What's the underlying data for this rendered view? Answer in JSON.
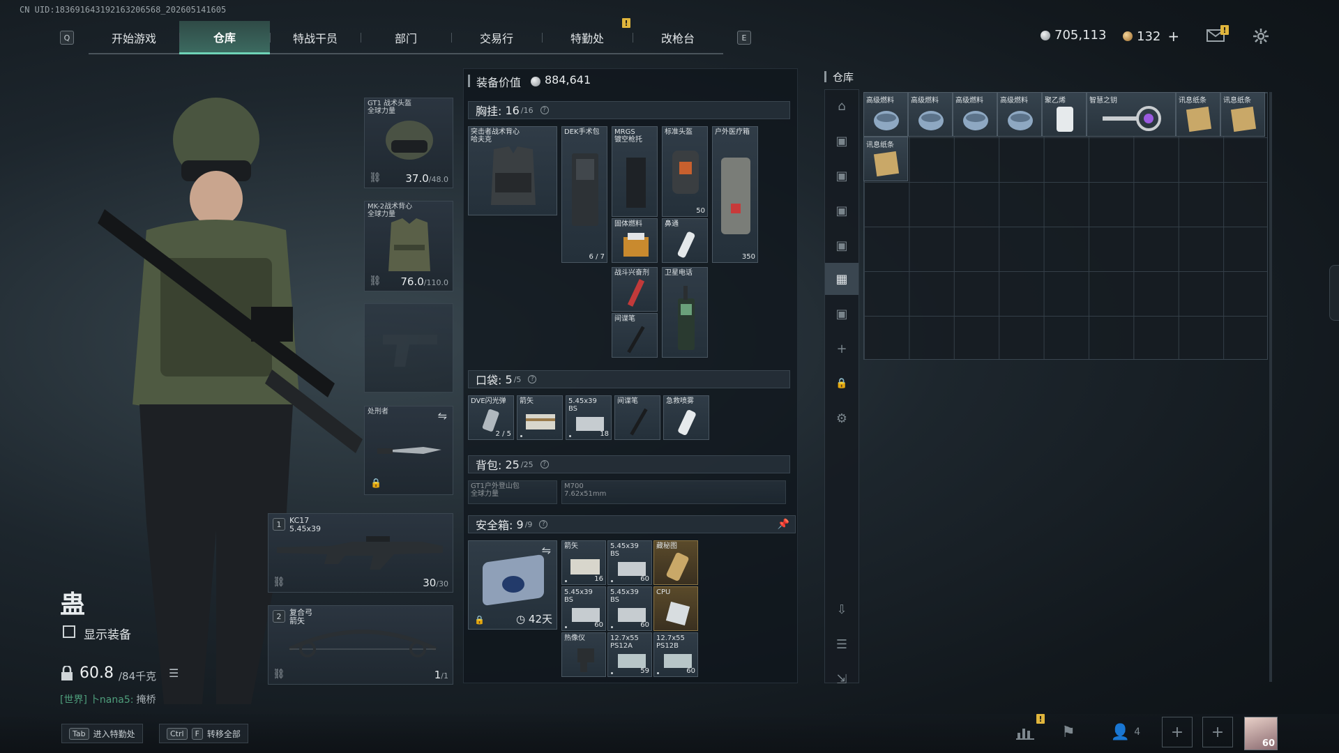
{
  "uid": "CN UID:18369164319216320656​8_202605141605",
  "topbar": {
    "left_key": "Q",
    "right_key": "E",
    "tabs": [
      "开始游戏",
      "仓库",
      "特战干员",
      "部门",
      "交易行",
      "特勤处",
      "改枪台"
    ],
    "active_tab": "仓库",
    "warn_mark": "!",
    "silver": "705,113",
    "gold": "132",
    "plus": "+"
  },
  "player": {
    "name": "蛊",
    "show_equipment_label": "显示装备",
    "weight": "60.8",
    "weight_max": "/84千克",
    "chat_channel": "[世界]",
    "chat_user": "卜nana5:",
    "chat_text": "掩桥"
  },
  "equipment": {
    "helmet": {
      "name": "GT1 战术头盔",
      "sub": "全球力量",
      "value": "37.0",
      "max": "/48.0"
    },
    "armor": {
      "name": "MK-2战术背心",
      "sub": "全球力量",
      "value": "76.0",
      "max": "/110.0"
    },
    "melee": {
      "name": "处刑者"
    },
    "weapon1": {
      "slot": "1",
      "name": "KC17",
      "caliber": "5.45x39",
      "ammo": "30",
      "ammo_max": "/30"
    },
    "weapon2": {
      "slot": "2",
      "name": "复合弓",
      "sub": "箭矢",
      "ammo": "1",
      "ammo_max": "/1"
    }
  },
  "loadout": {
    "title": "装备价值",
    "value": "884,641",
    "chest": {
      "label": "胸挂:",
      "count": "16",
      "cap": "/16"
    },
    "chest_items": [
      {
        "name": "突击者战术背心",
        "sub": "哈夫克"
      },
      {
        "name": "DEK手术包",
        "count": "6 / 7"
      },
      {
        "name": "MRGS",
        "sub": "镀空枪托"
      },
      {
        "name": "标准头盔",
        "count": "50"
      },
      {
        "name": "户外医疗箱",
        "count": "350"
      },
      {
        "name": "固体燃料"
      },
      {
        "name": "鼻通"
      },
      {
        "name": "战斗兴奋剂"
      },
      {
        "name": "卫星电话"
      },
      {
        "name": "间谍笔"
      }
    ],
    "pocket": {
      "label": "口袋:",
      "count": "5",
      "cap": "/5"
    },
    "pocket_items": [
      {
        "name": "DVE闪光弹",
        "count": "2 / 5"
      },
      {
        "name": "箭矢"
      },
      {
        "name": "5.45x39",
        "sub": "BS",
        "count": "18"
      },
      {
        "name": "间谍笔"
      },
      {
        "name": "急救喷雾"
      }
    ],
    "backpack": {
      "label": "背包:",
      "count": "25",
      "cap": "/25"
    },
    "backpack_items": [
      {
        "name": "GT1户外登山包",
        "sub": "全球力量"
      },
      {
        "name": "M700",
        "sub": "7.62x51mm"
      }
    ],
    "safebox": {
      "label": "安全箱:",
      "count": "9",
      "cap": "/9",
      "days": "42天"
    },
    "safebox_items": [
      {
        "name": "箭矢",
        "count": "16"
      },
      {
        "name": "5.45x39",
        "sub": "BS",
        "count": "60"
      },
      {
        "name": "藏秘图"
      },
      {
        "name": "5.45x39",
        "sub": "BS",
        "count": "60"
      },
      {
        "name": "5.45x39",
        "sub": "BS",
        "count": "60"
      },
      {
        "name": "CPU"
      },
      {
        "name": "热像仪"
      },
      {
        "name": "12.7x55",
        "sub": "PS12A",
        "count": "59"
      },
      {
        "name": "12.7x55",
        "sub": "PS12B",
        "count": "60"
      }
    ]
  },
  "warehouse": {
    "title": "仓库",
    "items": [
      {
        "name": "高级燃料"
      },
      {
        "name": "高级燃料"
      },
      {
        "name": "高级燃料"
      },
      {
        "name": "高级燃料"
      },
      {
        "name": "聚乙烯"
      },
      {
        "name": "智慧之钥"
      },
      {
        "name": "讯息纸条"
      },
      {
        "name": "讯息纸条"
      },
      {
        "name": "讯息纸条"
      }
    ]
  },
  "bottom": {
    "hint1_key": "Tab",
    "hint1_label": "进入特勤处",
    "hint2_key1": "Ctrl",
    "hint2_key2": "F",
    "hint2_label": "转移全部",
    "friends_count": "4",
    "avatar_level": "60"
  },
  "colors": {
    "accent": "#6fd3b7",
    "warn": "#e0b53c",
    "silver": "#c9ced2",
    "gold": "#d8a65a"
  }
}
